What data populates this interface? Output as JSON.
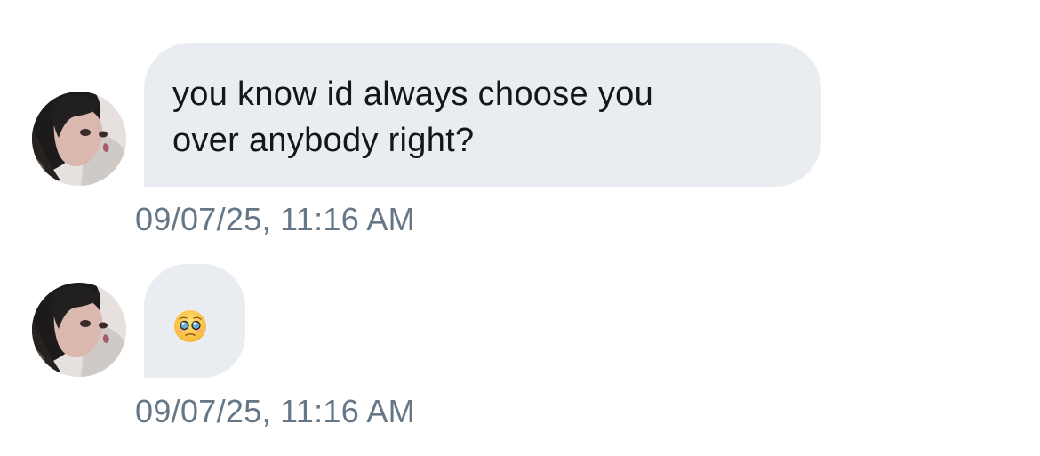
{
  "messages": [
    {
      "avatar_icon": "user-avatar-photo",
      "text": "you know id always choose you\nover anybody right?",
      "timestamp": "09/07/25, 11:16 AM"
    },
    {
      "avatar_icon": "user-avatar-photo",
      "text": "🥹",
      "emoji_icon": "pleading-face-holding-back-tears-emoji",
      "timestamp": "09/07/25, 11:16 AM"
    }
  ],
  "colors": {
    "bubble_background": "#e9ecf0",
    "message_text": "#14171a",
    "timestamp_text": "#657786",
    "page_background": "#ffffff"
  }
}
